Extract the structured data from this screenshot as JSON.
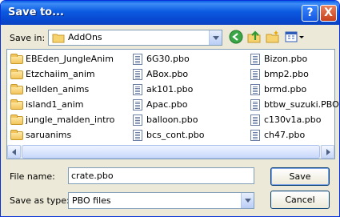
{
  "window": {
    "title": "Save to..."
  },
  "toolbar": {
    "save_in_label": "Save in:",
    "current_folder": "AddOns",
    "icons": [
      "back-icon",
      "up-folder-icon",
      "new-folder-icon",
      "view-menu-icon"
    ]
  },
  "files": {
    "col1": [
      {
        "name": "EBEden_JungleAnim",
        "type": "folder"
      },
      {
        "name": "Etzchaiim_anim",
        "type": "folder"
      },
      {
        "name": "hellden_anims",
        "type": "folder"
      },
      {
        "name": "island1_anim",
        "type": "folder"
      },
      {
        "name": "jungle_malden_intro",
        "type": "folder"
      },
      {
        "name": "saruanims",
        "type": "folder"
      }
    ],
    "col2": [
      {
        "name": "6G30.pbo",
        "type": "file"
      },
      {
        "name": "ABox.pbo",
        "type": "file"
      },
      {
        "name": "ak101.pbo",
        "type": "file"
      },
      {
        "name": "Apac.pbo",
        "type": "file"
      },
      {
        "name": "balloon.pbo",
        "type": "file"
      },
      {
        "name": "bcs_cont.pbo",
        "type": "file"
      }
    ],
    "col3": [
      {
        "name": "Bizon.pbo",
        "type": "file"
      },
      {
        "name": "bmp2.pbo",
        "type": "file"
      },
      {
        "name": "brmd.pbo",
        "type": "file"
      },
      {
        "name": "btbw_suzuki.PBO",
        "type": "file"
      },
      {
        "name": "c130v1a.pbo",
        "type": "file"
      },
      {
        "name": "ch47.pbo",
        "type": "file"
      }
    ]
  },
  "form": {
    "file_name_label": "File name:",
    "file_name_value": "crate.pbo",
    "save_as_type_label": "Save as type:",
    "save_as_type_value": "PBO files"
  },
  "buttons": {
    "save": "Save",
    "cancel": "Cancel",
    "help": "?",
    "close": "X"
  }
}
